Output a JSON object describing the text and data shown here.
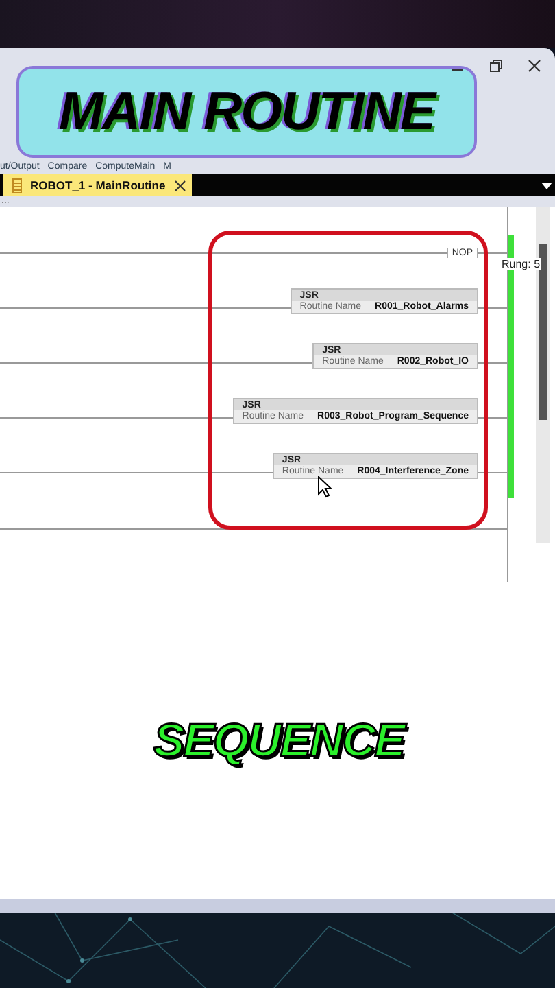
{
  "caption_top": "MAIN ROUTINE",
  "menu_bar": {
    "items": [
      "ut/Output",
      "Compare",
      "ComputeMain",
      "M"
    ]
  },
  "tabs": [
    {
      "label": "ROBOT_1 - MainRoutine",
      "selected": true
    }
  ],
  "pane_label": "...",
  "ladder": {
    "nop": "NOP",
    "rung_label": "Rung: 5",
    "highlighted": true,
    "instructions": [
      {
        "mnemonic": "JSR",
        "name_label": "Routine Name",
        "routine": "R001_Robot_Alarms"
      },
      {
        "mnemonic": "JSR",
        "name_label": "Routine Name",
        "routine": "R002_Robot_IO"
      },
      {
        "mnemonic": "JSR",
        "name_label": "Routine Name",
        "routine": "R003_Robot_Program_Sequence"
      },
      {
        "mnemonic": "JSR",
        "name_label": "Routine Name",
        "routine": "R004_Interference_Zone"
      }
    ]
  },
  "caption_bottom": "SEQUENCE"
}
